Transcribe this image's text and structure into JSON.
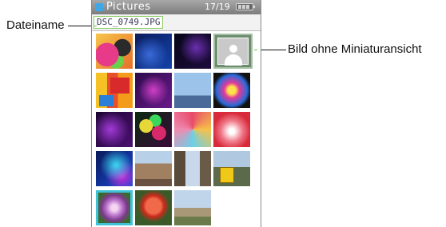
{
  "callouts": {
    "filename_label": "Dateiname",
    "no_thumbnail_label": "Bild ohne Miniaturansicht"
  },
  "titlebar": {
    "app_title": "Pictures",
    "counter": "17/19",
    "battery_icon": "battery-icon"
  },
  "filebar": {
    "filename": "DSC_0749.JPG"
  },
  "thumbnails": [
    {
      "name": "balloons-thumbnail",
      "selected": false
    },
    {
      "name": "blue-particles-thumbnail",
      "selected": false
    },
    {
      "name": "starfield-thumbnail",
      "selected": false
    },
    {
      "name": "no-thumbnail-placeholder",
      "selected": false
    },
    {
      "name": "color-blocks-thumbnail",
      "selected": false
    },
    {
      "name": "purple-smoke-thumbnail",
      "selected": false
    },
    {
      "name": "crowd-sky-thumbnail",
      "selected": false
    },
    {
      "name": "splash-thumbnail",
      "selected": false
    },
    {
      "name": "purple-abstract-thumbnail",
      "selected": false
    },
    {
      "name": "bokeh-thumbnail",
      "selected": false
    },
    {
      "name": "color-squares-thumbnail",
      "selected": false
    },
    {
      "name": "red-blur-thumbnail",
      "selected": false
    },
    {
      "name": "blue-waves-thumbnail",
      "selected": false
    },
    {
      "name": "old-building-thumbnail",
      "selected": false
    },
    {
      "name": "street-thumbnail",
      "selected": false
    },
    {
      "name": "tram-thumbnail",
      "selected": false
    },
    {
      "name": "purple-flower-thumbnail",
      "selected": true
    },
    {
      "name": "red-rose-thumbnail",
      "selected": false
    },
    {
      "name": "town-view-thumbnail",
      "selected": false
    }
  ],
  "colors": {
    "selection": "#3ec3d6",
    "callout_line": "#6cc15a"
  }
}
